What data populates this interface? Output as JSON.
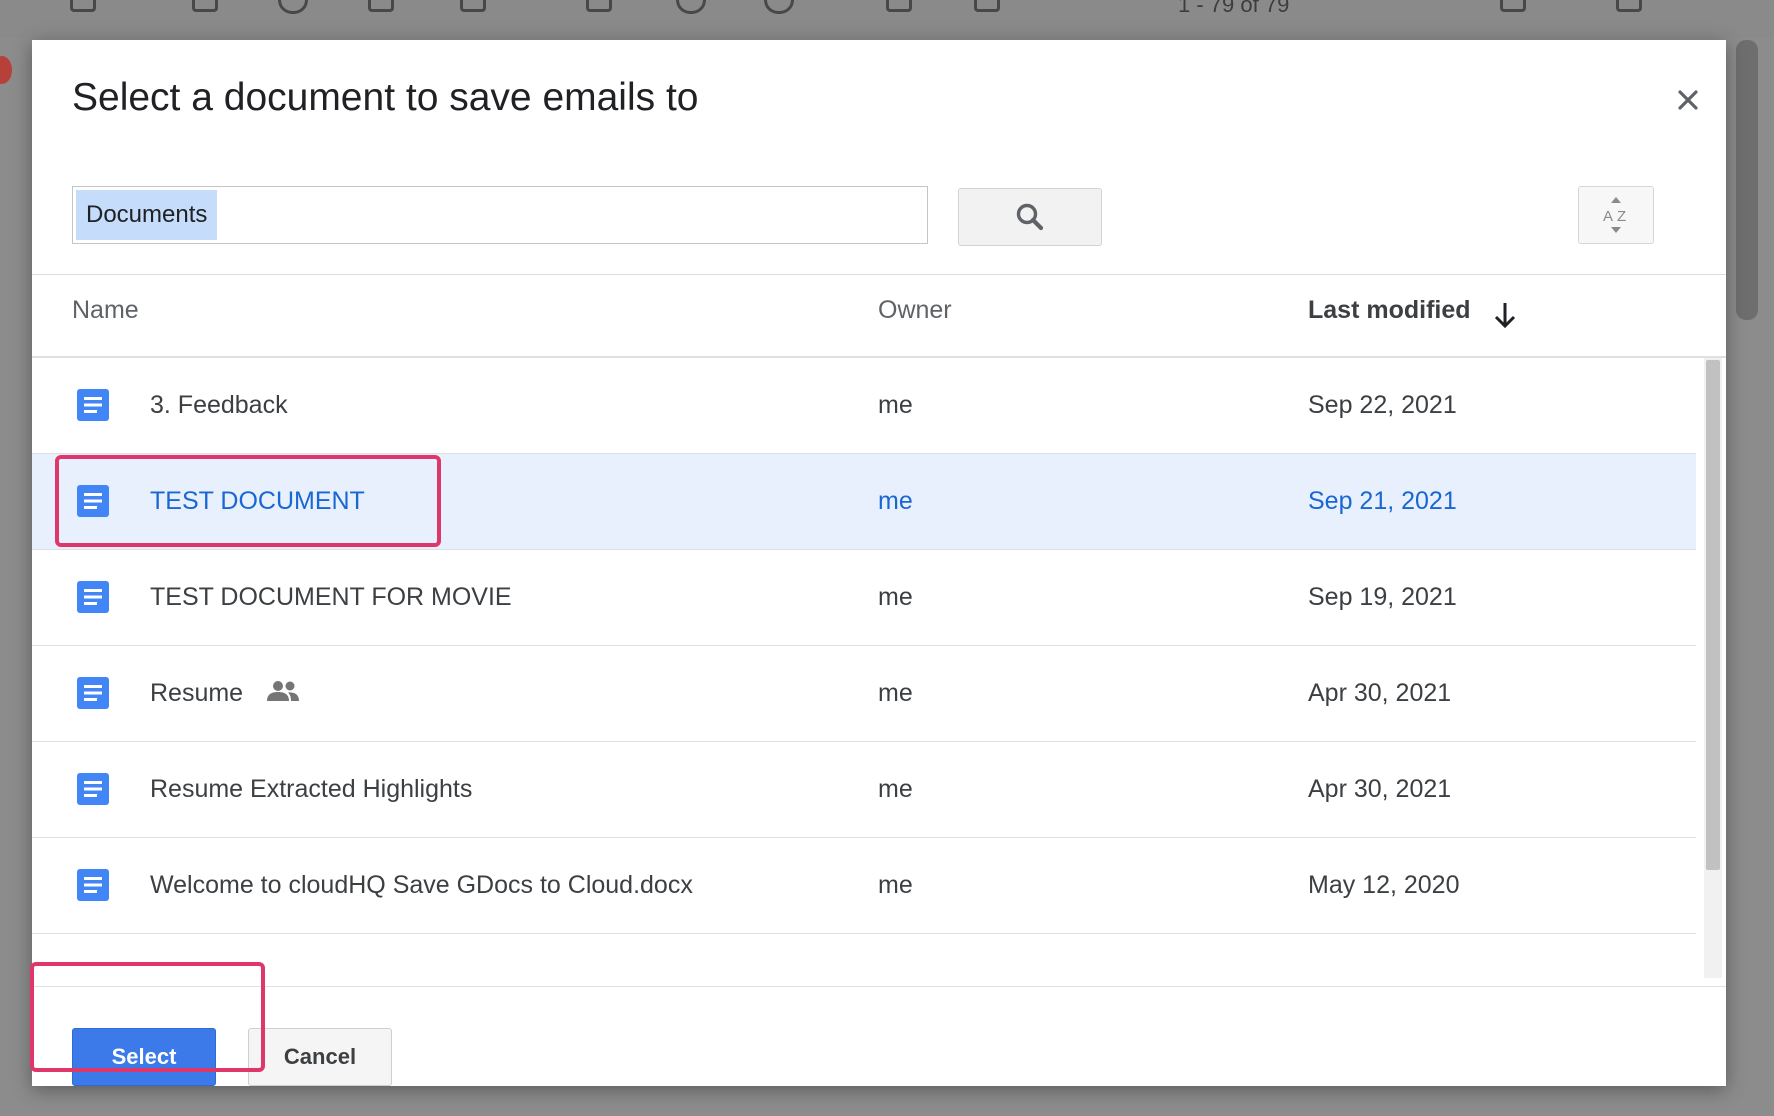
{
  "background": {
    "pager": "1 - 79 of 79"
  },
  "dialog": {
    "title": "Select a document to save emails to",
    "search": {
      "value": "Documents"
    },
    "columns": {
      "name": "Name",
      "owner": "Owner",
      "last_modified": "Last modified"
    },
    "rows": [
      {
        "name": "3. Feedback",
        "owner": "me",
        "modified": "Sep 22, 2021",
        "selected": false,
        "shared": false
      },
      {
        "name": "TEST DOCUMENT",
        "owner": "me",
        "modified": "Sep 21, 2021",
        "selected": true,
        "shared": false
      },
      {
        "name": "TEST DOCUMENT FOR MOVIE",
        "owner": "me",
        "modified": "Sep 19, 2021",
        "selected": false,
        "shared": false
      },
      {
        "name": "Resume",
        "owner": "me",
        "modified": "Apr 30, 2021",
        "selected": false,
        "shared": true
      },
      {
        "name": "Resume Extracted Highlights",
        "owner": "me",
        "modified": "Apr 30, 2021",
        "selected": false,
        "shared": false
      },
      {
        "name": "Welcome to cloudHQ Save GDocs to Cloud.docx",
        "owner": "me",
        "modified": "May 12, 2020",
        "selected": false,
        "shared": false
      }
    ],
    "buttons": {
      "select": "Select",
      "cancel": "Cancel"
    }
  },
  "colors": {
    "primary": "#3b7ae8",
    "selected_row": "#e8f0fe",
    "selected_text": "#1967d2",
    "doc_icon": "#4285f4",
    "highlight": "#e0376a"
  },
  "icons": {
    "close": "close-icon",
    "search": "search-icon",
    "sort": "sort-az-icon",
    "sort_direction": "arrow-down-icon",
    "document": "google-doc-icon",
    "shared": "people-icon"
  }
}
